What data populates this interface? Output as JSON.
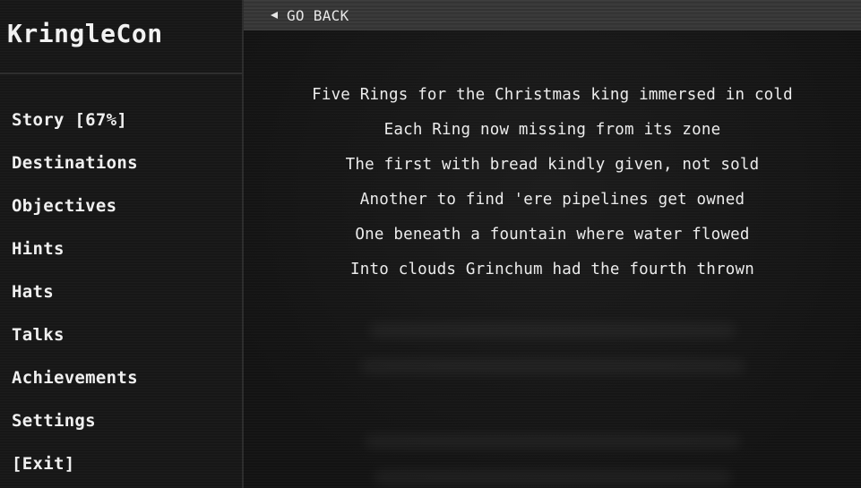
{
  "sidebar": {
    "brand": "KringleCon",
    "items": [
      {
        "label": "Story [67%]",
        "name": "story"
      },
      {
        "label": "Destinations",
        "name": "destinations"
      },
      {
        "label": "Objectives",
        "name": "objectives"
      },
      {
        "label": "Hints",
        "name": "hints"
      },
      {
        "label": "Hats",
        "name": "hats"
      },
      {
        "label": "Talks",
        "name": "talks"
      },
      {
        "label": "Achievements",
        "name": "achievements"
      },
      {
        "label": "Settings",
        "name": "settings"
      },
      {
        "label": "[Exit]",
        "name": "exit"
      }
    ]
  },
  "topbar": {
    "back_label": "GO BACK",
    "back_icon": "left-triangle-icon"
  },
  "story": {
    "lines": [
      "Five Rings for the Christmas king immersed in cold",
      "Each Ring now missing from its zone",
      "The first with bread kindly given, not sold",
      "Another to find 'ere pipelines get owned",
      "One beneath a fountain where water flowed",
      "Into clouds Grinchum had the fourth thrown"
    ]
  },
  "colors": {
    "background": "#161616",
    "text": "#ececec",
    "topbar": "#363636",
    "divider": "#2c2c2c"
  }
}
